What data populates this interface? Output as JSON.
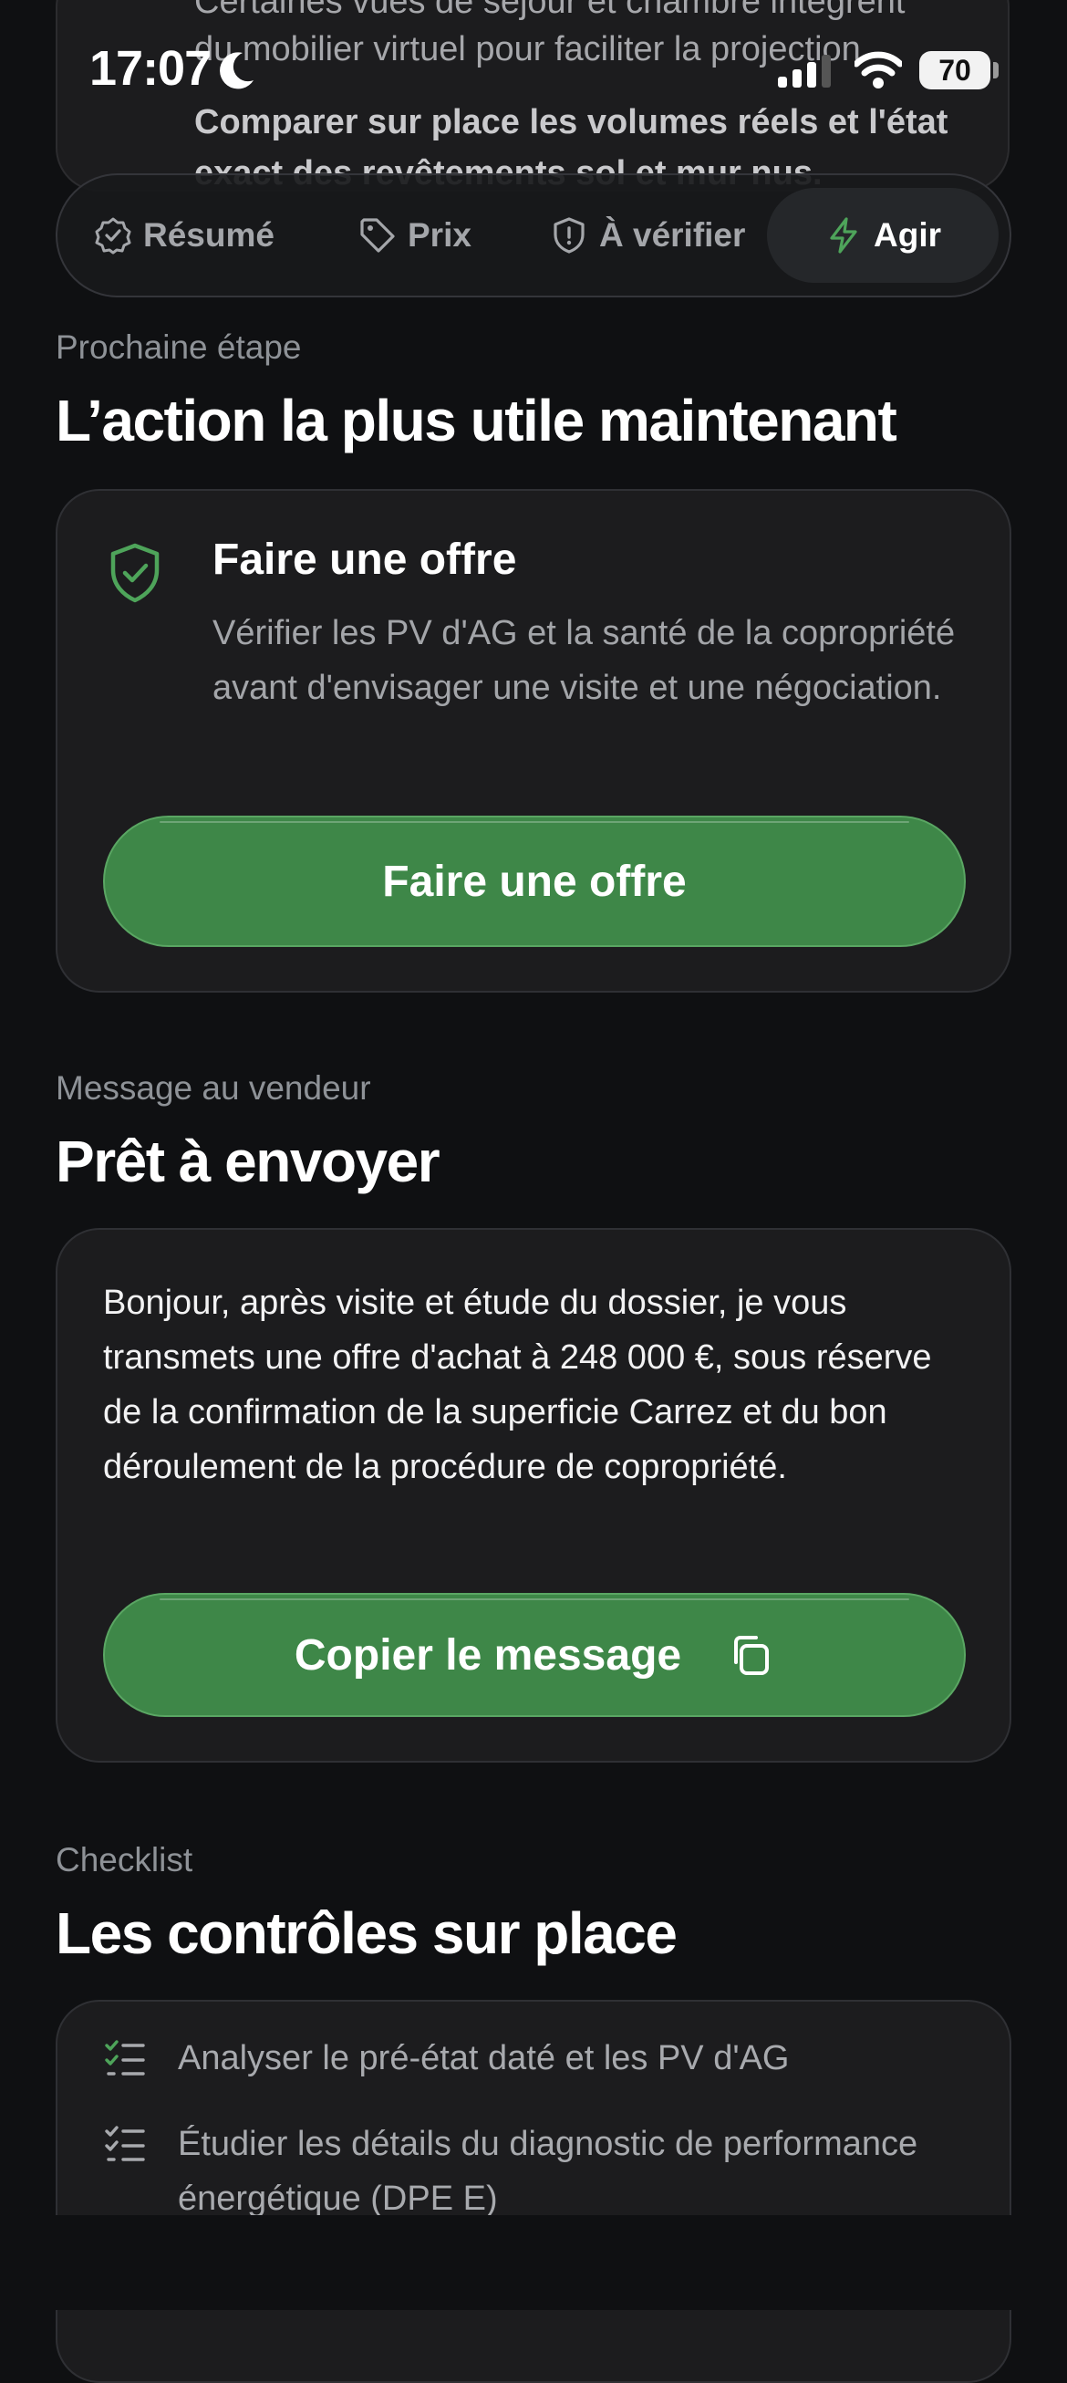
{
  "status_bar": {
    "time": "17:07",
    "battery": "70"
  },
  "previous_section": {
    "lines": [
      "Certaines vues de séjour et chambre intègrent",
      "du mobilier virtuel pour faciliter la projection.",
      "Comparer sur place les volumes réels et l'état",
      "exact des revêtements sol et mur nus."
    ]
  },
  "tabs": [
    {
      "label": "Résumé",
      "icon": "check-badge-icon"
    },
    {
      "label": "Prix",
      "icon": "tag-icon"
    },
    {
      "label": "À vérifier",
      "icon": "shield-alert-icon"
    },
    {
      "label": "Agir",
      "icon": "lightning-icon",
      "active": true
    }
  ],
  "next_step": {
    "eyebrow": "Prochaine étape",
    "title": "L’action la plus utile maintenant",
    "card": {
      "title": "Faire une offre",
      "description": "Vérifier les PV d'AG et la santé de la copropriété avant d'envisager une visite et une négociation.",
      "button_label": "Faire une offre"
    }
  },
  "message": {
    "eyebrow": "Message au vendeur",
    "title": "Prêt à envoyer",
    "body": "Bonjour, après visite et étude du dossier, je vous transmets une offre d'achat à 248 000 €, sous réserve de la confirmation de la superficie Carrez et du bon déroulement de la procédure de copropriété.",
    "button_label": "Copier le message"
  },
  "checklist": {
    "eyebrow": "Checklist",
    "title": "Les contrôles sur place",
    "items": [
      "Analyser le pré-état daté et les PV d'AG",
      "Étudier les détails du diagnostic de performance énergétique (DPE E)"
    ]
  },
  "colors": {
    "accent_green": "#3e8748",
    "background": "#0f1012",
    "card": "#1c1c1e"
  }
}
